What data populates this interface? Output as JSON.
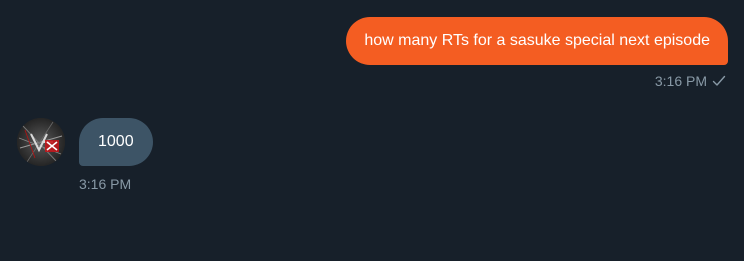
{
  "conversation": {
    "messages": [
      {
        "direction": "outgoing",
        "text": "how many RTs for a sasuke special next episode",
        "time": "3:16 PM",
        "status_icon": "checkmark-icon"
      },
      {
        "direction": "incoming",
        "text": "1000",
        "time": "3:16 PM",
        "avatar_icon": "user-avatar"
      }
    ]
  },
  "colors": {
    "background": "#17202a",
    "outgoing_bubble": "#f45d22",
    "incoming_bubble": "#3d5466",
    "timestamp": "#8899a6",
    "text": "#ffffff"
  }
}
